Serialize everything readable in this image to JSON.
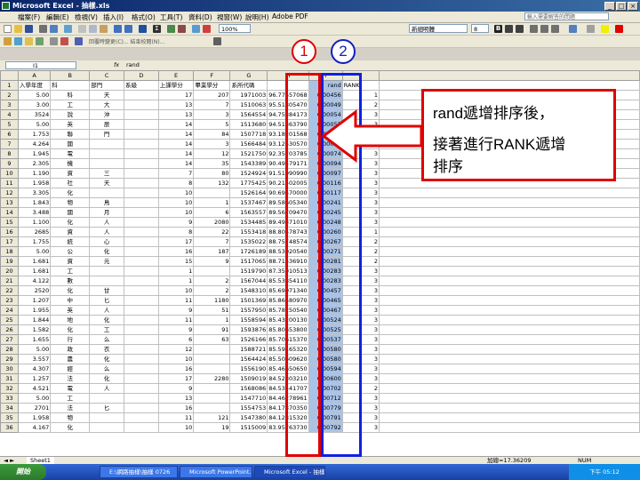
{
  "window": {
    "title": "Microsoft Excel - 抽樣.xls",
    "buttons": [
      "_",
      "□",
      "×"
    ]
  },
  "menu": {
    "items": [
      "檔案(F)",
      "編輯(E)",
      "檢視(V)",
      "插入(I)",
      "格式(O)",
      "工具(T)",
      "資料(D)",
      "視窗(W)",
      "說明(H)",
      "Adobe PDF"
    ],
    "help_placeholder": "輸入需要解答的問題"
  },
  "toolbar": {
    "zoom": "100%",
    "font_name": "新細明體",
    "font_size": "8",
    "reply_text": "回覆時變更(C)... 結束校閱(N)..."
  },
  "formula_bar": {
    "cell_ref": "I1",
    "fx": "fx",
    "content": "rand"
  },
  "columns": [
    "A",
    "B",
    "C",
    "D",
    "E",
    "F",
    "G",
    "H",
    "I",
    "J"
  ],
  "header_row": [
    "入學年度",
    "科",
    "部門",
    "系級",
    "上課學分",
    "畢業學分",
    "系所代碼",
    "",
    "rand",
    "RANK"
  ],
  "rows": [
    [
      "5.00",
      "科",
      "天",
      "",
      "17",
      "207",
      "1971003",
      "96.77557068",
      "0.00456",
      "1"
    ],
    [
      "3.00",
      "工",
      "大",
      "",
      "13",
      "7",
      "1510063",
      "95.51305470",
      "0.00049",
      "2"
    ],
    [
      "3524",
      "說",
      "沖",
      "",
      "13",
      "3",
      "1564554",
      "94.75384173",
      "0.00054",
      "3"
    ],
    [
      "5.00",
      "英",
      "辰",
      "",
      "14",
      "5",
      "1513680",
      "94.51363790",
      "0.00057",
      "3"
    ],
    [
      "1.753",
      "聯",
      "門",
      "",
      "14",
      "84",
      "1507718",
      "93.18201568",
      "0.00058",
      "3"
    ],
    [
      "4.264",
      "國",
      "",
      "",
      "14",
      "3",
      "1566484",
      "93.12530570",
      "0.00059",
      "3"
    ],
    [
      "1.945",
      "電",
      "",
      "",
      "14",
      "12",
      "1521750",
      "92.35703785",
      "0.00074",
      "3"
    ],
    [
      "2.305",
      "機",
      "",
      "",
      "14",
      "35",
      "1543389",
      "90.49479171",
      "0.00094",
      "3"
    ],
    [
      "1.190",
      "資",
      "三",
      "",
      "7",
      "80",
      "1524924",
      "91.51990990",
      "0.00097",
      "3"
    ],
    [
      "1.958",
      "社",
      "天",
      "",
      "8",
      "132",
      "1775425",
      "90.21402005",
      "0.00116",
      "3"
    ],
    [
      "3.305",
      "化",
      "",
      "",
      "10",
      "",
      "1526164",
      "90.69570000",
      "0.00117",
      "3"
    ],
    [
      "1.843",
      "物",
      "鳥",
      "",
      "10",
      "1",
      "1537467",
      "89.58605340",
      "0.00241",
      "3"
    ],
    [
      "3.488",
      "國",
      "月",
      "",
      "10",
      "6",
      "1563557",
      "89.56709470",
      "0.00245",
      "3"
    ],
    [
      "1.100",
      "化",
      "人",
      "",
      "9",
      "2080",
      "1534485",
      "89.49371010",
      "0.00248",
      "3"
    ],
    [
      "2685",
      "資",
      "人",
      "",
      "8",
      "22",
      "1553418",
      "88.80578743",
      "0.00260",
      "1"
    ],
    [
      "1.755",
      "統",
      "心",
      "",
      "17",
      "7",
      "1535022",
      "88.75748574",
      "0.00267",
      "2"
    ],
    [
      "5.00",
      "公",
      "化",
      "",
      "16",
      "187",
      "1726189",
      "88.53020540",
      "0.00271",
      "2"
    ],
    [
      "1.681",
      "資",
      "元",
      "",
      "15",
      "9",
      "1517065",
      "88.71536910",
      "0.00281",
      "2"
    ],
    [
      "1.681",
      "工",
      "",
      "",
      "1",
      "",
      "1519790",
      "87.35910513",
      "0.00283",
      "3"
    ],
    [
      "4.122",
      "數",
      "",
      "",
      "1",
      "2",
      "1567044",
      "85.53854110",
      "0.00283",
      "3"
    ],
    [
      "2520",
      "化",
      "甘",
      "",
      "10",
      "2",
      "1548310",
      "85.69071340",
      "0.00457",
      "3"
    ],
    [
      "1.207",
      "中",
      "匕",
      "",
      "11",
      "1180",
      "1501369",
      "85.86580970",
      "0.00465",
      "3"
    ],
    [
      "1.955",
      "英",
      "人",
      "",
      "9",
      "51",
      "1557950",
      "85.78250540",
      "0.00467",
      "3"
    ],
    [
      "1.844",
      "地",
      "化",
      "",
      "11",
      "1",
      "1558594",
      "85.43200130",
      "0.00524",
      "3"
    ],
    [
      "1.582",
      "化",
      "工",
      "",
      "9",
      "91",
      "1593876",
      "85.80653800",
      "0.00525",
      "3"
    ],
    [
      "1.655",
      "行",
      "么",
      "",
      "6",
      "63",
      "1526166",
      "85.70615370",
      "0.00537",
      "3"
    ],
    [
      "5.00",
      "政",
      "衣",
      "",
      "12",
      "",
      "1588721",
      "85.59165320",
      "0.00580",
      "3"
    ],
    [
      "3.557",
      "農",
      "化",
      "",
      "10",
      "",
      "1564424",
      "85.50609620",
      "0.00580",
      "3"
    ],
    [
      "4.307",
      "經",
      "么",
      "",
      "16",
      "",
      "1556190",
      "85.46650650",
      "0.00594",
      "3"
    ],
    [
      "1.257",
      "法",
      "化",
      "",
      "17",
      "2280",
      "1509019",
      "84.52303210",
      "0.00600",
      "3"
    ],
    [
      "4.521",
      "電",
      "人",
      "",
      "9",
      "",
      "1568086",
      "84.53441707",
      "0.00702",
      "2"
    ],
    [
      "5.00",
      "工",
      "",
      "",
      "13",
      "",
      "1547710",
      "84.46278961",
      "0.00712",
      "3"
    ],
    [
      "2701",
      "法",
      "匕",
      "",
      "16",
      "",
      "1554753",
      "84.17370350",
      "0.00779",
      "3"
    ],
    [
      "1.958",
      "物",
      "",
      "",
      "11",
      "121",
      "1547380",
      "84.12315320",
      "0.00791",
      "3"
    ],
    [
      "4.167",
      "化",
      "",
      "",
      "10",
      "19",
      "1515009",
      "83.95763730",
      "0.00792",
      "3"
    ]
  ],
  "annotations": {
    "circle1": "1",
    "circle2": "2",
    "callout_line1": "rand遞增排序後，",
    "callout_line2": "接著進行RANK遞增",
    "callout_line3": "排序"
  },
  "status": {
    "sheet_tab": "Sheet1",
    "sum_text": "加總=17.36209",
    "mode": "NUM"
  },
  "taskbar": {
    "start": "開始",
    "tasks": [
      "E:\\網路抽樣\\抽樣 0726",
      "Microsoft PowerPoint...",
      "Microsoft Excel - 抽樣..."
    ],
    "clock": "下午 05:12"
  },
  "colors": {
    "red": "#e00000",
    "blue": "#1020e0",
    "column_highlight": "#a9c3e8"
  }
}
